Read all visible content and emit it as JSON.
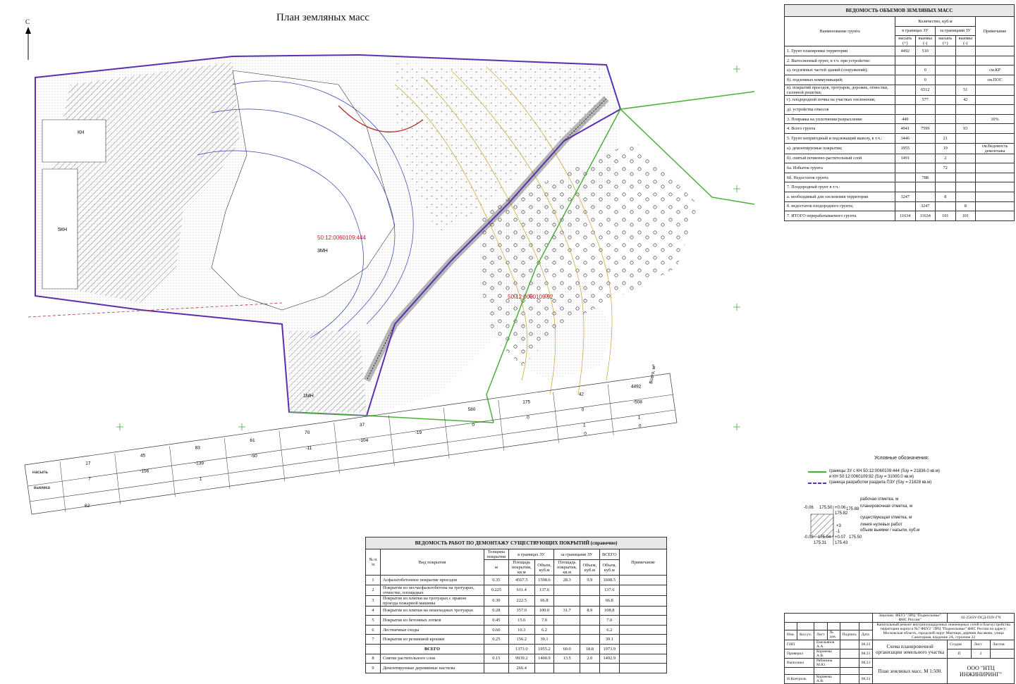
{
  "page_title": "План земляных масс",
  "map": {
    "cadastral_label_1": "50:12:0060109:444",
    "cadastral_label_2": "50:12:0060109:92",
    "zone_label": "3МН",
    "zone_kn": "КН",
    "zone_5kn": "5КН",
    "zone_1mn": "1МН",
    "north_arrow": "С"
  },
  "bottom_grid": {
    "row_labels": [
      "насыпь",
      "выемка"
    ],
    "side_label": "Всего, м³",
    "fill_values": [
      "17",
      "45",
      "83",
      "61",
      "70",
      "37",
      "",
      "580",
      "175",
      "42",
      "4492"
    ],
    "cut_values": [
      "7",
      "-156",
      "-139",
      "-50",
      "-11",
      "-104",
      "-19",
      "0",
      "0",
      "0",
      "-508"
    ],
    "extra_values": [
      "",
      "",
      "1",
      "",
      "",
      "",
      "",
      "",
      "",
      "1",
      "1"
    ],
    "zero_values": [
      "",
      "",
      "",
      "",
      "",
      "",
      "",
      "",
      "",
      "0",
      "0"
    ],
    "total_left": "62"
  },
  "volume_table": {
    "caption": "ВЕДОМОСТЬ ОБЪЕМОВ ЗЕМЛЯНЫХ МАСС",
    "col_name": "Наименование грунта",
    "col_qty": "Количество, куб.м",
    "col_in": "в границах ЗУ",
    "col_out": "за границами ЗУ",
    "col_fill": "насыпь (+)",
    "col_cut": "выемка (-)",
    "col_note": "Примечание",
    "rows": [
      {
        "name": "1. Грунт планировки территории",
        "a": "4492",
        "b": "510",
        "c": "",
        "d": "",
        "note": ""
      },
      {
        "name": "2. Вытесненный грунт, в т.ч. при устройстве:",
        "a": "",
        "b": "",
        "c": "",
        "d": "",
        "note": ""
      },
      {
        "name": "а). подземных частей зданий (сооружений);",
        "a": "",
        "b": "0",
        "c": "",
        "d": "",
        "note": "см.КР"
      },
      {
        "name": "б). подземных коммуникаций;",
        "a": "",
        "b": "0",
        "c": "",
        "d": "",
        "note": "см.ПОС"
      },
      {
        "name": "в). покрытий проездов, тротуаров, дорожек, отмостки, газонной решетки;",
        "a": "",
        "b": "6512",
        "c": "",
        "d": "51",
        "note": ""
      },
      {
        "name": "г). плодородной почвы на участках озеленения;",
        "a": "",
        "b": "577",
        "c": "",
        "d": "42",
        "note": ""
      },
      {
        "name": "д). устройства откосов",
        "a": "",
        "b": "",
        "c": "",
        "d": "",
        "note": ""
      },
      {
        "name": "3. Поправка на уплотнение/разрыхление",
        "a": "449",
        "b": "",
        "c": "",
        "d": "",
        "note": "10%"
      },
      {
        "name": "4. Всего грунта",
        "a": "4941",
        "b": "7599",
        "c": "",
        "d": "93",
        "note": ""
      },
      {
        "name": "5. Грунт непригодный и подлежащий вывозу, в т.ч.:",
        "a": "3446",
        "b": "",
        "c": "21",
        "d": "",
        "note": ""
      },
      {
        "name": "а). демонтируемые покрытия;",
        "a": "1955",
        "b": "",
        "c": "19",
        "d": "",
        "note": "см.Ведомость демонтажа"
      },
      {
        "name": "б). снятый почвенно-растительный слой",
        "a": "1491",
        "b": "",
        "c": "2",
        "d": "",
        "note": ""
      },
      {
        "name": "6а. Избыток грунта",
        "a": "",
        "b": "",
        "c": "72",
        "d": "",
        "note": ""
      },
      {
        "name": "6б. Недостаток грунта",
        "a": "",
        "b": "788",
        "c": "",
        "d": "",
        "note": ""
      },
      {
        "name": "7. Плодородный грунт в т.ч.:",
        "a": "",
        "b": "",
        "c": "",
        "d": "",
        "note": ""
      },
      {
        "name": "а. необходимый для озеленения территории",
        "a": "3247",
        "b": "",
        "c": "8",
        "d": "",
        "note": ""
      },
      {
        "name": "б. недостаток плодородного грунта;",
        "a": "",
        "b": "3247",
        "c": "",
        "d": "8",
        "note": ""
      },
      {
        "name": "7. ИТОГО перерабатываемого грунта",
        "a": "11634",
        "b": "11634",
        "c": "101",
        "d": "101",
        "note": ""
      }
    ]
  },
  "demolition_table": {
    "caption": "ВЕДОМОСТЬ РАБОТ ПО ДЕМОНТАЖУ СУЩЕСТВУЮЩИХ ПОКРЫТИЙ (справочно)",
    "col_no": "№ п /п",
    "col_type": "Вид покрытия",
    "col_thick": "Толщина покрытия",
    "col_thick_unit": "м",
    "col_in": "в границах ЗУ",
    "col_out": "за границами ЗУ",
    "col_total": "ВСЕГО",
    "col_area": "Площадь покрытия, кв.м",
    "col_vol": "Объем, куб.м",
    "col_note": "Примечание",
    "rows": [
      {
        "no": "1",
        "type": "Асфальтобетонное покрытие проездов",
        "t": "0.35",
        "a1": "4567.5",
        "v1": "1598.6",
        "a2": "28.3",
        "v2": "9.9",
        "tot": "1608.5"
      },
      {
        "no": "2",
        "type": "Покрытие из песчасфальтобетона на тротуарах, отмостке, площадках",
        "t": "0.225",
        "a1": "611.4",
        "v1": "137.6",
        "a2": "",
        "v2": "",
        "tot": "137.6"
      },
      {
        "no": "3",
        "type": "Покрытие из плитки на тротуарах с правом проезда пожарной машины",
        "t": "0.30",
        "a1": "222.5",
        "v1": "66.8",
        "a2": "",
        "v2": "",
        "tot": "66.8"
      },
      {
        "no": "4",
        "type": "Покрытие из плитки на пешеходных тротуарах",
        "t": "0.28",
        "a1": "357.0",
        "v1": "100.0",
        "a2": "31.7",
        "v2": "8.9",
        "tot": "108.8"
      },
      {
        "no": "5",
        "type": "Покрытие из бетонных лотков",
        "t": "0.45",
        "a1": "15.6",
        "v1": "7.0",
        "a2": "",
        "v2": "",
        "tot": "7.0"
      },
      {
        "no": "6",
        "type": "Лестничные сходы",
        "t": "0.60",
        "a1": "10.3",
        "v1": "6.2",
        "a2": "",
        "v2": "",
        "tot": "6.2"
      },
      {
        "no": "7",
        "type": "Покрытие из резиновой крошки",
        "t": "0.25",
        "a1": "156.2",
        "v1": "39.1",
        "a2": "",
        "v2": "",
        "tot": "39.1"
      },
      {
        "no": "",
        "type": "ВСЕГО",
        "t": "",
        "a1": "1373.0",
        "v1": "1955.2",
        "a2": "60.0",
        "v2": "18.8",
        "tot": "1973.9"
      },
      {
        "no": "8",
        "type": "Снятие растительного слоя",
        "t": "0.15",
        "a1": "9939.2",
        "v1": "1490.9",
        "a2": "13.5",
        "v2": "2.0",
        "tot": "1492.9"
      },
      {
        "no": "9",
        "type": "Демонтируемые деревянные настилы",
        "t": "",
        "a1": "266.4",
        "v1": "",
        "a2": "",
        "v2": "",
        "tot": ""
      }
    ]
  },
  "legend": {
    "title": "Условные обозначения:",
    "line1": "границы ЗУ с КН 50:12:0060109:444 (Sзу = 21836.0 кв.м)",
    "line2": "и КН 50:12:0060109:92 (Sзу = 31000.0 кв.м)",
    "line3": "граница разработки раздела ПЗУ (Sзу = 21828 кв.м)",
    "d1": "рабочая отметка, м",
    "d2": "планировочная отметка, м",
    "d3": "существующая отметка, м",
    "d4": "линия нулевых работ",
    "d5": "объем выемки / насыпи, куб.м",
    "n1": "-0.06",
    "n2": "175.50",
    "n3": "+0.06",
    "n4": "175.88",
    "n5": "175.82",
    "n6": "-0.03",
    "n7": "175.04",
    "n8": "+0.07",
    "n9": "175.50",
    "n10": "175.31",
    "n11": "175.43",
    "n12": "+3",
    "n13": "-1"
  },
  "stamp": {
    "doc_code": "02-2503У-ПСД-ПЗУ-ГЧ",
    "customer": "Заказчик: ФБУЗ \"ЛРЦ \"Подмосковье\" ФНС России\"",
    "project": "Капитальный ремонт внутриплощадочных инженерных сетей и благоустройства территории корпуса №7 ФБУЗ \"ЛРЦ \"Подмосковье\" ФНС России по адресу: Московская область, городской округ Мытищи, деревня Аксаково, улица Санаторная, владение 2А, строение 22",
    "sheet_title": "Схема планировочной организации земельного участка",
    "drawing_title": "План земляных масс. М 1:500.",
    "company": "ООО \"НТЦ ИНЖИНИРИНГ\"",
    "stage_label": "Стадия",
    "sheet_label": "Лист",
    "sheets_label": "Листов",
    "stage": "П",
    "sheet": "2",
    "sheets": "",
    "h_izm": "Изм.",
    "h_kol": "Кол.уч.",
    "h_list": "Лист",
    "h_ndok": "№ док.",
    "h_podp": "Подпись",
    "h_data": "Дата",
    "roles": [
      {
        "role": "ГИП",
        "name": "Емельянов А.А.",
        "date": "08.23"
      },
      {
        "role": "Проверил",
        "name": "Корнеева А.В.",
        "date": "08.23"
      },
      {
        "role": "Выполнил",
        "name": "Рябинина М.Ю.",
        "date": "08.23"
      },
      {
        "role": "",
        "name": "",
        "date": ""
      },
      {
        "role": "Н.Контроль",
        "name": "Корнеева А.В.",
        "date": "08.23"
      }
    ]
  }
}
